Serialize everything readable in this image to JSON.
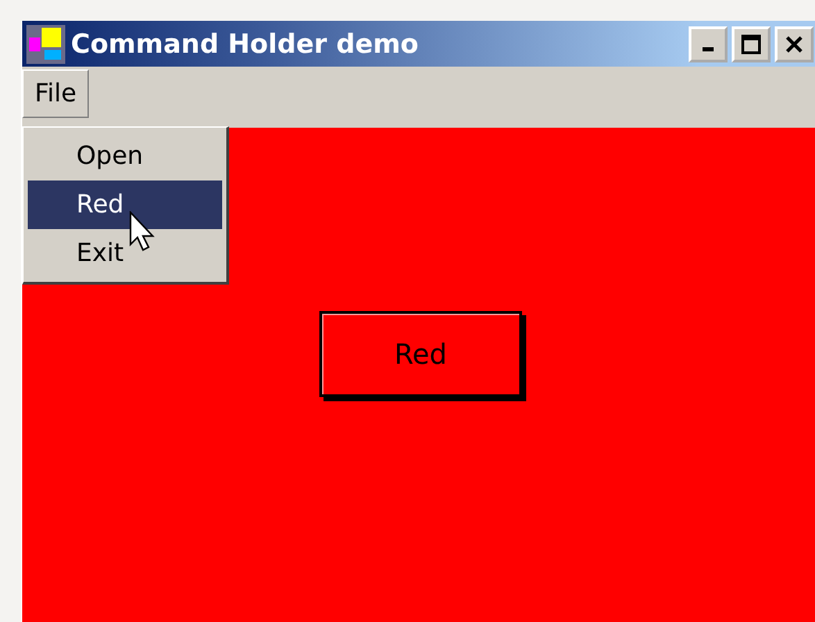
{
  "window": {
    "title": "Command Holder demo"
  },
  "menu_bar": [
    {
      "label": "File",
      "selected": true
    }
  ],
  "menu": [
    {
      "label": "Open",
      "selected": false
    },
    {
      "label": "Red",
      "selected": true
    },
    {
      "label": "Exit",
      "selected": false
    }
  ],
  "button": {
    "label": "Red"
  }
}
